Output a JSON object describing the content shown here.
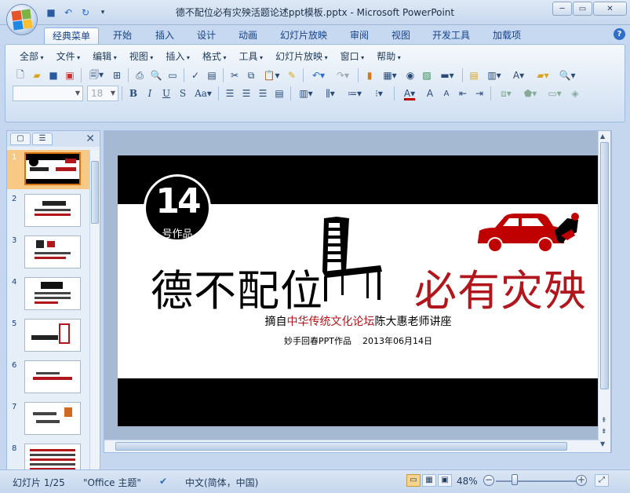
{
  "window": {
    "title": "德不配位必有灾殃活题论述ppt模板.pptx - Microsoft PowerPoint",
    "controls": {
      "minimize": "─",
      "maximize": "▭",
      "close": "✕"
    }
  },
  "quick_access": [
    {
      "name": "save-icon",
      "glyph": "💾"
    },
    {
      "name": "undo-icon",
      "glyph": "↶"
    },
    {
      "name": "redo-icon",
      "glyph": "↷"
    },
    {
      "name": "customize-icon",
      "glyph": "▾"
    }
  ],
  "tabs": [
    "经典菜单",
    "开始",
    "插入",
    "设计",
    "动画",
    "幻灯片放映",
    "审阅",
    "视图",
    "开发工具",
    "加载项"
  ],
  "active_tab": "经典菜单",
  "menus": [
    "全部",
    "文件",
    "编辑",
    "视图",
    "插入",
    "格式",
    "工具",
    "幻灯片放映",
    "窗口",
    "帮助"
  ],
  "toolbar": {
    "font_name": "",
    "font_size": "18",
    "font_color": "#c00000"
  },
  "pane": {
    "tab_slides": "▢",
    "tab_outline": "☰",
    "close": "✕",
    "slide_numbers": [
      "1",
      "2",
      "3",
      "4",
      "5",
      "6",
      "7",
      "8"
    ],
    "selected": "1"
  },
  "slide": {
    "badge_number": "14",
    "badge_label": "号作品",
    "title_left": "德不配位",
    "title_right": "必有灾殃",
    "subtitle_prefix": "摘自",
    "subtitle_highlight": "中华传统文化论坛",
    "subtitle_suffix": "陈大惠老师讲座",
    "credit_author": "妙手回春PPT作品",
    "credit_date": "2013年06月14日",
    "colors": {
      "band": "#000000",
      "accent": "#b0161b"
    }
  },
  "status": {
    "slide_info": "幻灯片 1/25",
    "theme": "\"Office 主题\"",
    "language": "中文(简体，中国)",
    "zoom": "48%",
    "zoom_out": "−",
    "zoom_in": "+"
  }
}
